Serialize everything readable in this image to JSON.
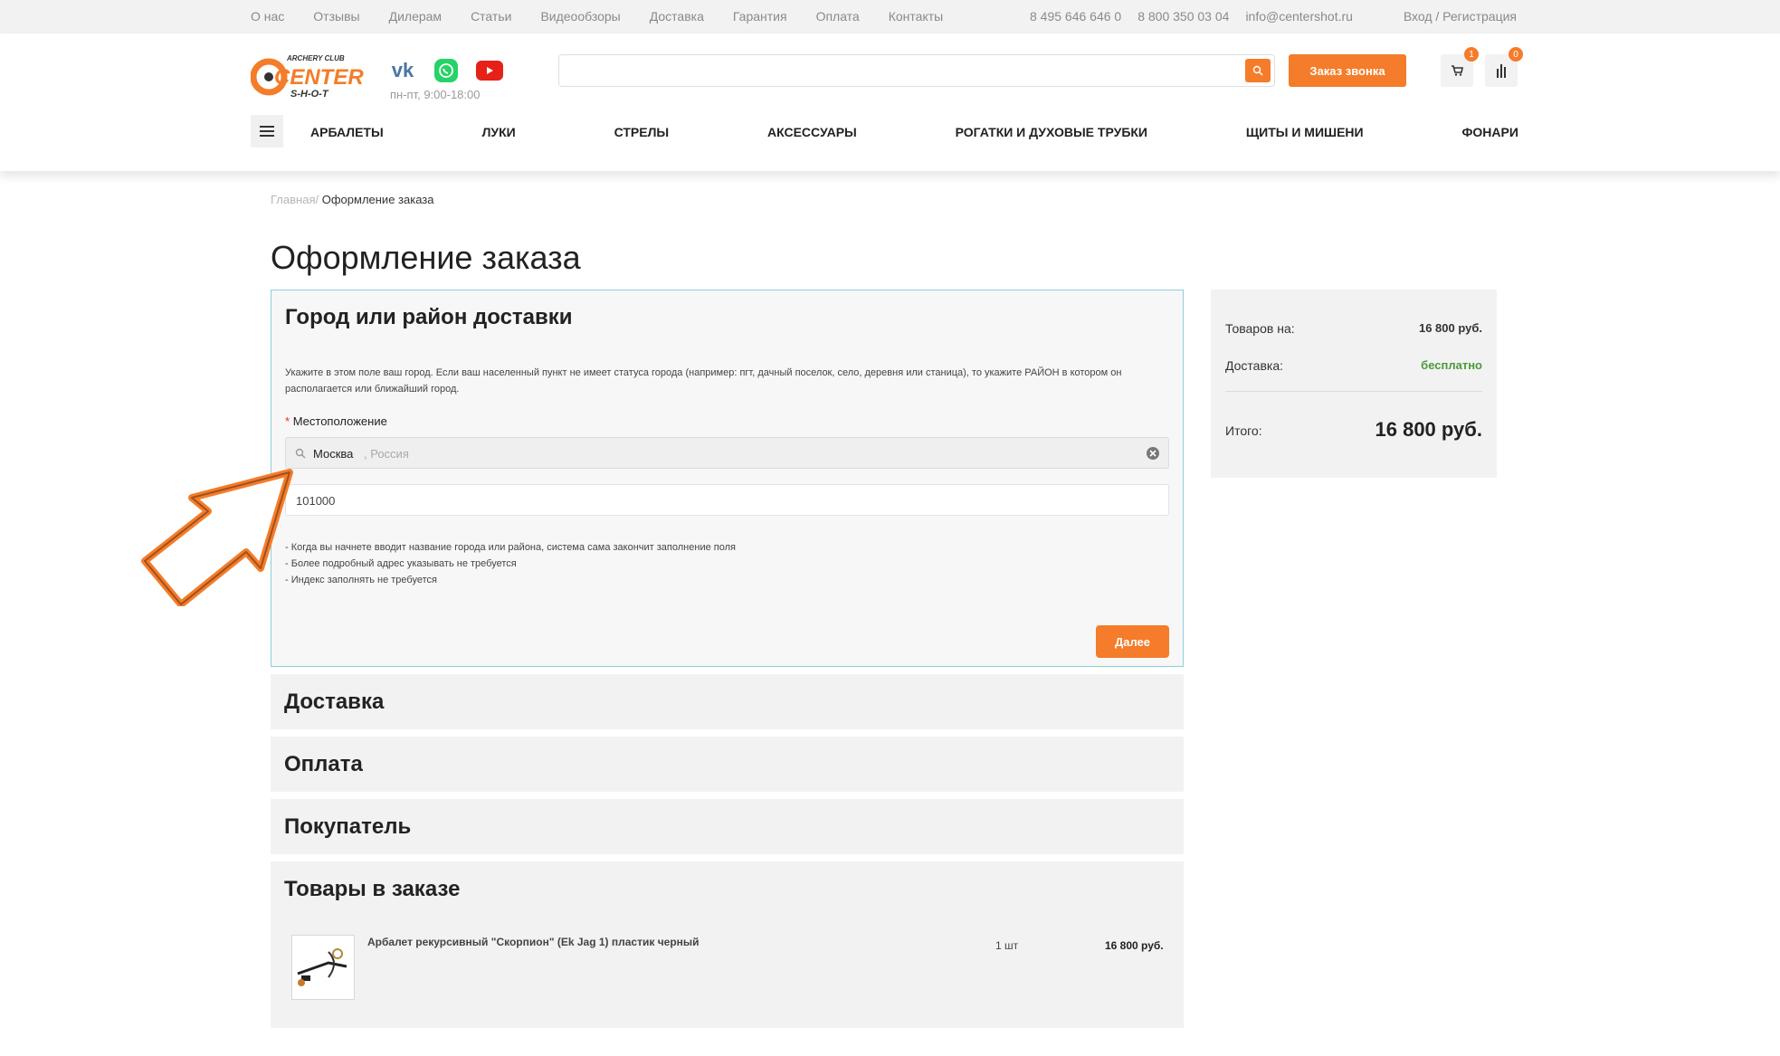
{
  "topbar": {
    "links": [
      "О нас",
      "Отзывы",
      "Дилерам",
      "Статьи",
      "Видеообзоры",
      "Доставка",
      "Гарантия",
      "Оплата",
      "Контакты"
    ],
    "phone1": "8 495 646 646 0",
    "phone2": "8 800 350 03 04",
    "email": "info@centershot.ru",
    "login": "Вход / Регистрация"
  },
  "header": {
    "logo_text_top": "ARCHERY CLUB",
    "logo_text_main": "CENTER",
    "logo_text_bottom": "S-H-O-T",
    "hours": "пн-пт, 9:00-18:00",
    "callback": "Заказ звонка",
    "cart_count": "1",
    "compare_count": "0",
    "icons": [
      "vk-icon",
      "whatsapp-icon",
      "youtube-icon",
      "search-icon",
      "cart-icon",
      "compare-icon",
      "menu-icon"
    ],
    "accent_color": "#f47c2a"
  },
  "menu": [
    "АРБАЛЕТЫ",
    "ЛУКИ",
    "СТРЕЛЫ",
    "АКСЕССУАРЫ",
    "РОГАТКИ И ДУХОВЫЕ ТРУБКИ",
    "ЩИТЫ И МИШЕНИ",
    "ФОНАРИ"
  ],
  "breadcrumb": {
    "home": "Главная",
    "separator": "/",
    "current": "Оформление заказа"
  },
  "page_title": "Оформление заказа",
  "location_section": {
    "title": "Город или район доставки",
    "description": "Укажите в этом поле ваш город. Если ваш населенный пункт не имеет статуса города (например: пгт, дачный поселок, село, деревня или станица), то укажите РАЙОН в котором он располагается или ближайший город.",
    "label": "Местоположение",
    "required_mark": "*",
    "city": "Москва",
    "country": ", Россия",
    "zip": "101000",
    "hints": [
      "- Когда вы начнете вводит название города или района, система сама закончит заполнение поля",
      "- Более подробный адрес указывать не требуется",
      "- Индекс заполнять не требуется"
    ],
    "next_button": "Далее"
  },
  "sections": {
    "delivery": "Доставка",
    "payment": "Оплата",
    "buyer": "Покупатель",
    "items": "Товары в заказе"
  },
  "order_item": {
    "name": "Арбалет рекурсивный \"Скорпион\" (Ek Jag 1) пластик черный",
    "qty": "1 шт",
    "price": "16 800 руб."
  },
  "summary": {
    "goods_label": "Товаров на:",
    "goods_value": "16 800 руб.",
    "delivery_label": "Доставка:",
    "delivery_value": "бесплатно",
    "total_label": "Итого:",
    "total_value": "16 800 руб."
  }
}
